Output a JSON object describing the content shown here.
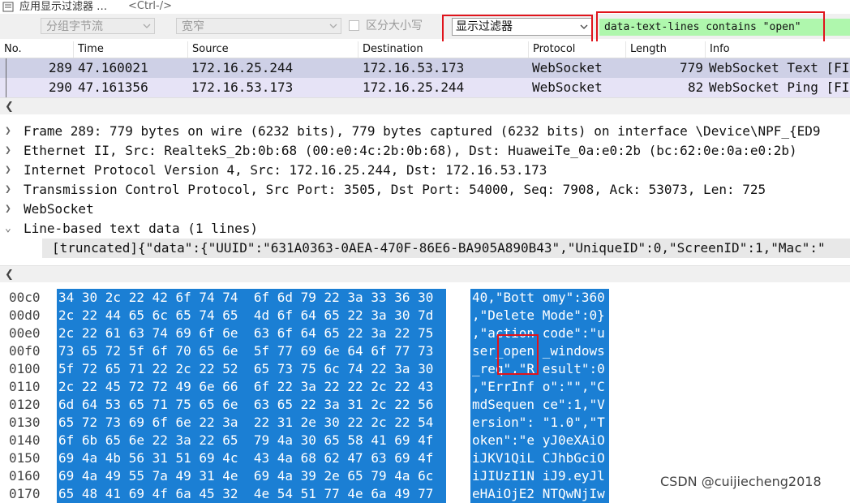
{
  "topbar": {
    "label": "应用显示过滤器 …",
    "hint": "<Ctrl-/>"
  },
  "toolbar": {
    "group_separator": "分组字节流",
    "width": "宽窄",
    "case_sensitive": "区分大小写",
    "filter_type": "显示过滤器",
    "filter_value": "data-text-lines contains \"open\""
  },
  "packet_list": {
    "columns": [
      "No.",
      "Time",
      "Source",
      "Destination",
      "Protocol",
      "Length",
      "Info"
    ],
    "rows": [
      {
        "no": "289",
        "time": "47.160021",
        "source": "172.16.25.244",
        "destination": "172.16.53.173",
        "protocol": "WebSocket",
        "length": "779",
        "info": "WebSocket Text [FI"
      },
      {
        "no": "290",
        "time": "47.161356",
        "source": "172.16.53.173",
        "destination": "172.16.25.244",
        "protocol": "WebSocket",
        "length": "82",
        "info": "WebSocket Ping [FI"
      }
    ]
  },
  "details": {
    "rows": [
      "Frame 289: 779 bytes on wire (6232 bits), 779 bytes captured (6232 bits) on interface \\Device\\NPF_{ED9",
      "Ethernet II, Src: RealtekS_2b:0b:68 (00:e0:4c:2b:0b:68), Dst: HuaweiTe_0a:e0:2b (bc:62:0e:0a:e0:2b)",
      "Internet Protocol Version 4, Src: 172.16.25.244, Dst: 172.16.53.173",
      "Transmission Control Protocol, Src Port: 3505, Dst Port: 54000, Seq: 7908, Ack: 53073, Len: 725",
      "WebSocket",
      "Line-based text data (1 lines)"
    ],
    "truncated": "[truncated]{\"data\":{\"UUID\":\"631A0363-0AEA-470F-86E6-BA905A890B43\",\"UniqueID\":0,\"ScreenID\":1,\"Mac\":\""
  },
  "hex": {
    "rows": [
      {
        "offset": "00c0",
        "bytes": "34 30 2c 22 42 6f 74 74  6f 6d 79 22 3a 33 36 30",
        "ascii": "40,\"Bott omy\":360"
      },
      {
        "offset": "00d0",
        "bytes": "2c 22 44 65 6c 65 74 65  4d 6f 64 65 22 3a 30 7d",
        "ascii": ",\"Delete Mode\":0}"
      },
      {
        "offset": "00e0",
        "bytes": "2c 22 61 63 74 69 6f 6e  63 6f 64 65 22 3a 22 75",
        "ascii": ",\"action code\":\"u"
      },
      {
        "offset": "00f0",
        "bytes": "73 65 72 5f 6f 70 65 6e  5f 77 69 6e 64 6f 77 73",
        "ascii": "ser_open _windows"
      },
      {
        "offset": "0100",
        "bytes": "5f 72 65 71 22 2c 22 52  65 73 75 6c 74 22 3a 30",
        "ascii": "_req\",\"R esult\":0"
      },
      {
        "offset": "0110",
        "bytes": "2c 22 45 72 72 49 6e 66  6f 22 3a 22 22 2c 22 43",
        "ascii": ",\"ErrInf o\":\"\",\"C"
      },
      {
        "offset": "0120",
        "bytes": "6d 64 53 65 71 75 65 6e  63 65 22 3a 31 2c 22 56",
        "ascii": "mdSequen ce\":1,\"V"
      },
      {
        "offset": "0130",
        "bytes": "65 72 73 69 6f 6e 22 3a  22 31 2e 30 22 2c 22 54",
        "ascii": "ersion\": \"1.0\",\"T"
      },
      {
        "offset": "0140",
        "bytes": "6f 6b 65 6e 22 3a 22 65  79 4a 30 65 58 41 69 4f",
        "ascii": "oken\":\"e yJ0eXAiO"
      },
      {
        "offset": "0150",
        "bytes": "69 4a 4b 56 31 51 69 4c  43 4a 68 62 47 63 69 4f",
        "ascii": "iJKV1QiL CJhbGciO"
      },
      {
        "offset": "0160",
        "bytes": "69 4a 49 55 7a 49 31 4e  69 4a 39 2e 65 79 4a 6c",
        "ascii": "iJIUzI1N iJ9.eyJl"
      },
      {
        "offset": "0170",
        "bytes": "65 48 41 69 4f 6a 45 32  4e 54 51 77 4e 6a 49 77",
        "ascii": "eHAiOjE2 NTQwNjIw"
      }
    ]
  },
  "watermark": "CSDN @cuijiecheng2018",
  "colors": {
    "selected_row": "#ced0e6",
    "second_row": "#e6e3f6",
    "hex_highlight": "#1b7fd4",
    "filter_valid": "#aff7ad",
    "annotation_box": "#e0141c"
  }
}
